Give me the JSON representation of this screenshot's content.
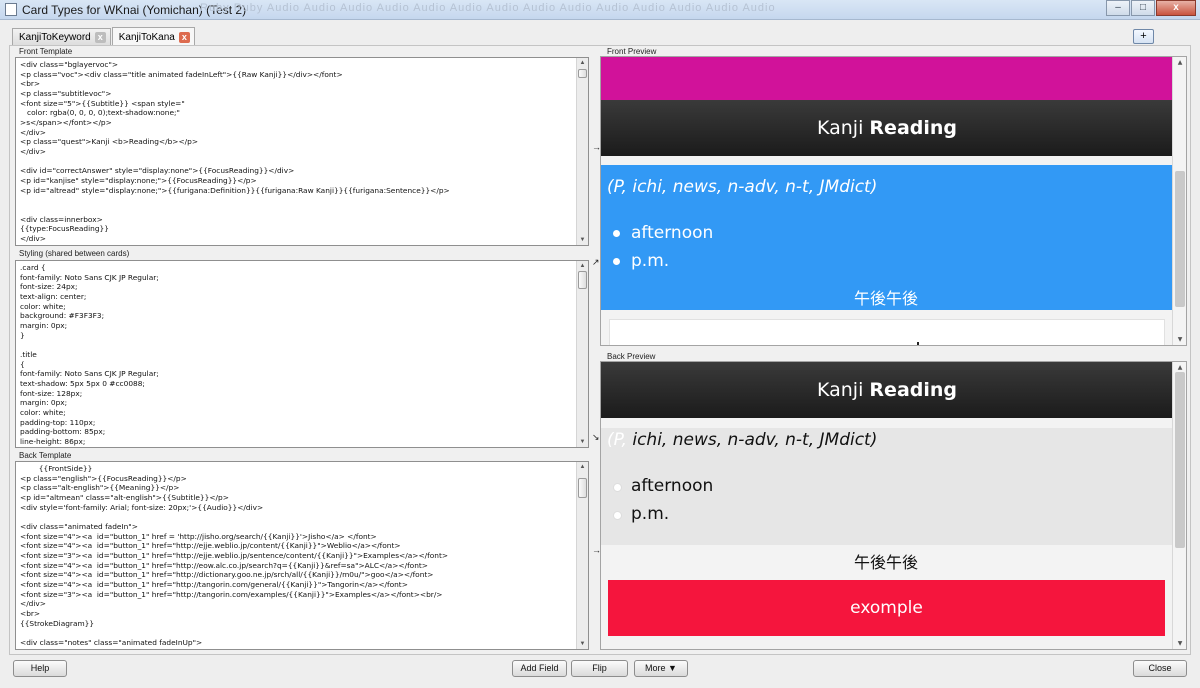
{
  "window": {
    "title": "Card Types for WKnai (Yomichan) (Test 2)",
    "background_strip": "Ruby  Ruby  Audio  Audio  Audio  Audio  Audio  Audio  Audio  Audio  Audio  Audio  Audio  Audio  Audio  Audio",
    "buttons": {
      "minimize": "–",
      "maximize": "□",
      "close": "x"
    }
  },
  "tabs": [
    {
      "label": "KanjiToKeyword",
      "close": "x"
    },
    {
      "label": "KanjiToKana",
      "close": "x"
    }
  ],
  "add_tab_label": "+",
  "sections": {
    "front_template": "Front Template",
    "styling": "Styling (shared between cards)",
    "back_template": "Back Template",
    "front_preview": "Front Preview",
    "back_preview": "Back Preview"
  },
  "code": {
    "front": "<div class=\"bglayervoc\">\n<p class=\"voc\"><div class=\"title animated fadeInLeft\">{{Raw Kanji}}</div></font>\n<br>\n<p class=\"subtitlevoc\">\n<font size=\"5\">{{Subtitle}} <span style=\"\n   color: rgba(0, 0, 0, 0);text-shadow:none;\"\n>s</span></font></p>\n</div>\n<p class=\"quest\">Kanji <b>Reading</b></p>\n</div>\n\n<div id=\"correctAnswer\" style=\"display:none\">{{FocusReading}}</div>\n<p id=\"kanjise\" style=\"display:none;\">{{FocusReading}}</p>\n<p id=\"altread\" style=\"display:none;\">{{furigana:Definition}}{{furigana:Raw Kanji}}{{furigana:Sentence}}</p>\n\n\n<div class=innerbox>\n{{type:FocusReading}}\n</div>",
    "styling": ".card {\nfont-family: Noto Sans CJK JP Regular;\nfont-size: 24px;\ntext-align: center;\ncolor: white;\nbackground: #F3F3F3;\nmargin: 0px;\n}\n\n.title\n{\nfont-family: Noto Sans CJK JP Regular;\ntext-shadow: 5px 5px 0 #cc0088;\nfont-size: 128px;\nmargin: 0px;\ncolor: white;\npadding-top: 110px;\npadding-bottom: 85px;\nline-height: 86px;",
    "back": "        {{FrontSide}}\n<p class=\"english\">{{FocusReading}}</p>\n<p class=\"alt-english\">{{Meaning}}</p>\n<p id=\"altmean\" class=\"alt-english\">{{Subtitle}}</p>\n<div style='font-family: Arial; font-size: 20px;'>{{Audio}}</div>\n\n<div class=\"animated fadeIn\">\n<font size=\"4\"><a  id=\"button_1\" href = 'http://jisho.org/search/{{Kanji}}'>Jisho</a> </font>\n<font size=\"4\"><a  id=\"button_1\" href=\"http://ejje.weblio.jp/content/{{Kanji}}\">Weblio</a></font>\n<font size=\"3\"><a  id=\"button_1\" href=\"http://ejje.weblio.jp/sentence/content/{{Kanji}}\">Examples</a></font>\n<font size=\"4\"><a  id=\"button_1\" href=\"http://eow.alc.co.jp/search?q={{Kanji}}&ref=sa\">ALC</a></font>\n<font size=\"4\"><a  id=\"button_1\" href=\"http://dictionary.goo.ne.jp/srch/all/{{Kanji}}/m0u/\">goo</a></font>\n<font size=\"4\"><a  id=\"button_1\" href=\"http://tangorin.com/general/{{Kanji}}\">Tangorin</a></font>\n<font size=\"3\"><a  id=\"button_1\" href=\"http://tangorin.com/examples/{{Kanji}}\">Examples</a></font><br/>\n</div>\n<br>\n{{StrokeDiagram}}\n\n<div class=\"notes\" class=\"animated fadeInUp\">"
  },
  "side_arrows": {
    "front": "→",
    "styling_up": "↗",
    "styling_down": "↘",
    "back": "→"
  },
  "front_preview": {
    "heading_plain": "Kanji ",
    "heading_bold": "Reading",
    "definition": "(P, ichi, news, n-adv, n-t, JMdict)",
    "bullets": [
      "afternoon",
      "p.m."
    ],
    "furigana": "午後午後"
  },
  "back_preview": {
    "heading_plain": "Kanji ",
    "heading_bold": "Reading",
    "definition_ghost": "(P,",
    "definition": " ichi, news, n-adv, n-t, JMdict)",
    "bullets": [
      "afternoon",
      "p.m."
    ],
    "furigana": "午後午後",
    "button_label": "exomple"
  },
  "colors": {
    "magenta": "#d1129a",
    "blue": "#3299f5",
    "red": "#f5153d",
    "dark": "#1b1b1b"
  },
  "bottom_buttons": {
    "help": "Help",
    "add_field": "Add Field",
    "flip": "Flip",
    "more": "More ▼",
    "close": "Close"
  }
}
